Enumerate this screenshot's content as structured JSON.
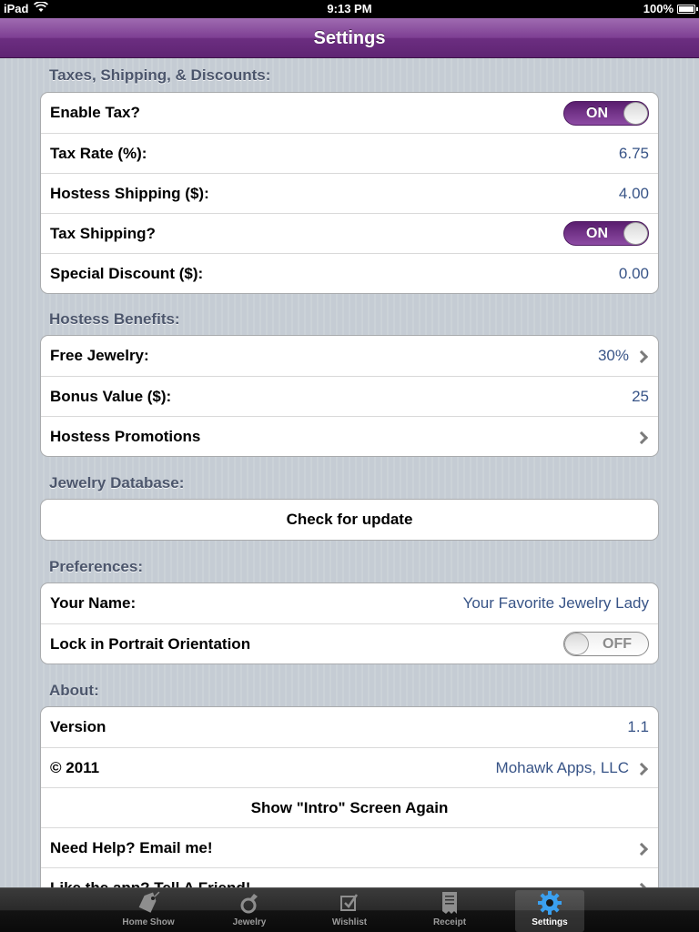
{
  "status_bar": {
    "device": "iPad",
    "time": "9:13 PM",
    "battery": "100%"
  },
  "nav": {
    "title": "Settings"
  },
  "sections": {
    "taxes": {
      "header": "Taxes, Shipping, & Discounts:",
      "enable_tax": {
        "label": "Enable Tax?",
        "state": "ON"
      },
      "tax_rate": {
        "label": "Tax Rate (%):",
        "value": "6.75"
      },
      "hostess_shipping": {
        "label": "Hostess Shipping ($):",
        "value": "4.00"
      },
      "tax_shipping": {
        "label": "Tax Shipping?",
        "state": "ON"
      },
      "special_discount": {
        "label": "Special Discount ($):",
        "value": "0.00"
      }
    },
    "benefits": {
      "header": "Hostess Benefits:",
      "free_jewelry": {
        "label": "Free Jewelry:",
        "value": "30%"
      },
      "bonus_value": {
        "label": "Bonus Value ($):",
        "value": "25"
      },
      "promotions": {
        "label": "Hostess Promotions"
      }
    },
    "database": {
      "header": "Jewelry Database:",
      "check_update": {
        "label": "Check for update"
      }
    },
    "preferences": {
      "header": "Preferences:",
      "your_name": {
        "label": "Your Name:",
        "value": "Your Favorite Jewelry Lady"
      },
      "lock_portrait": {
        "label": "Lock in Portrait Orientation",
        "state": "OFF"
      }
    },
    "about": {
      "header": "About:",
      "version": {
        "label": "Version",
        "value": "1.1"
      },
      "copyright": {
        "label": "© 2011",
        "value": "Mohawk Apps, LLC"
      },
      "intro": {
        "label": "Show \"Intro\" Screen Again"
      },
      "help": {
        "label": "Need Help? Email me!"
      },
      "tell_friend": {
        "label": "Like the app? Tell A Friend!"
      }
    }
  },
  "tabs": [
    {
      "label": "Home Show",
      "icon": "price-tag-icon"
    },
    {
      "label": "Jewelry",
      "icon": "ring-icon"
    },
    {
      "label": "Wishlist",
      "icon": "checkbox-icon"
    },
    {
      "label": "Receipt",
      "icon": "receipt-icon"
    },
    {
      "label": "Settings",
      "icon": "gear-icon",
      "active": true
    }
  ],
  "colors": {
    "nav_purple": "#7e3f93",
    "switch_on": "#6c2e81",
    "value_blue": "#385487",
    "section_header": "#4c566c",
    "tab_active_icon": "#3aa0f0"
  }
}
